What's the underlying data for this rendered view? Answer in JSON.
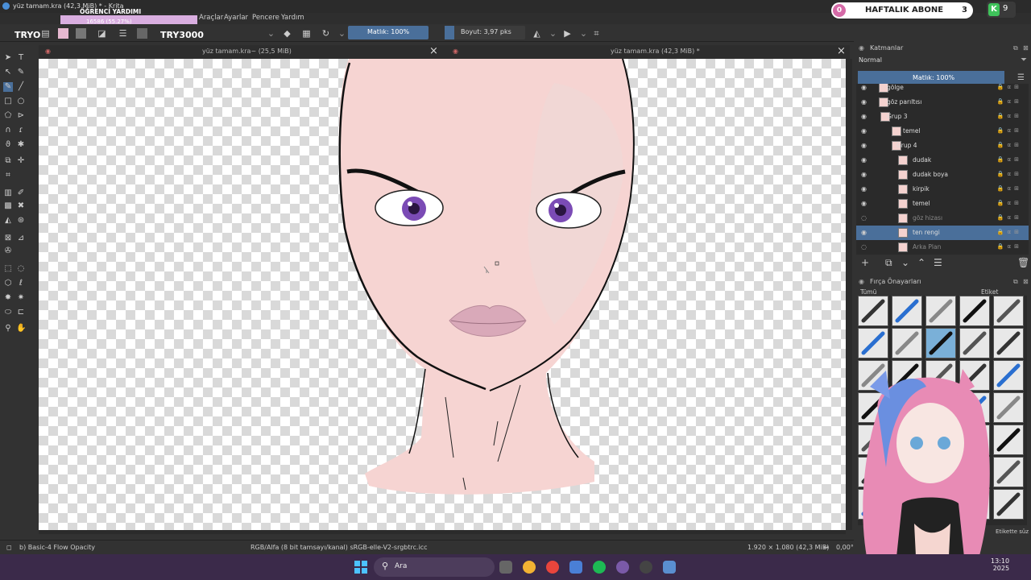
{
  "window": {
    "title": "yüz tamam.kra (42,3 MiB) * - Krita"
  },
  "menu": {
    "items": [
      "Araçlar",
      "Ayarlar",
      "Pencere",
      "Yardım"
    ]
  },
  "overlay": {
    "title": "ÖĞRENCİ YARDIMI",
    "progress": "16586 (55.27%)",
    "progress_fraction": 0.5527
  },
  "stream": {
    "sub_label": "HAFTALIK ABONE",
    "sub_left": "0",
    "sub_right": "3",
    "green_count": "9"
  },
  "toolbar": {
    "try_left": "TRYO",
    "try_right": "TRY3000",
    "opacity": "Matlık: 100%",
    "size": "Boyut: 3,97 pks"
  },
  "tabs": [
    {
      "title": "yüz tamam.kra~ (25,5 MiB)",
      "close": "×"
    },
    {
      "title": "yüz tamam.kra (42,3 MiB) *",
      "close": "×"
    }
  ],
  "layers_panel": {
    "title": "Katmanlar",
    "blend_mode": "Normal",
    "opacity": "Matlık: 100%",
    "layers": [
      {
        "name": "gölge",
        "dim": false,
        "selected": false
      },
      {
        "name": "göz parıltısı",
        "dim": false,
        "selected": false
      },
      {
        "name": "Grup 3",
        "dim": false,
        "selected": false
      },
      {
        "name": "temel",
        "dim": false,
        "selected": false
      },
      {
        "name": "Grup 4",
        "dim": false,
        "selected": false
      },
      {
        "name": "dudak",
        "dim": false,
        "selected": false
      },
      {
        "name": "dudak boya",
        "dim": false,
        "selected": false
      },
      {
        "name": "kirpik",
        "dim": false,
        "selected": false
      },
      {
        "name": "temel",
        "dim": false,
        "selected": false
      },
      {
        "name": "göz hizası",
        "dim": true,
        "selected": false
      },
      {
        "name": "ten rengi",
        "dim": false,
        "selected": true
      },
      {
        "name": "Arka Plan",
        "dim": true,
        "selected": false
      }
    ]
  },
  "brush_panel": {
    "title": "Fırça Önayarları",
    "filter": "Tümü",
    "tag_label": "Etiket",
    "tag_search": "Etikette süz"
  },
  "status": {
    "brush": "b) Basic-4 Flow Opacity",
    "color": "RGB/Alfa (8 bit tamsayı/kanal) sRGB-elle-V2-srgbtrc.icc",
    "dimensions": "1.920 × 1.080 (42,3 MiB)",
    "rotation": "0,00°"
  },
  "taskbar": {
    "search": "Ara",
    "time": "13:10",
    "year": "2025"
  },
  "colors": {
    "accent": "#4a6f9a",
    "skin": "#f6d4d2",
    "eye": "#7b4bb5",
    "lips": "#d9a9b9"
  }
}
